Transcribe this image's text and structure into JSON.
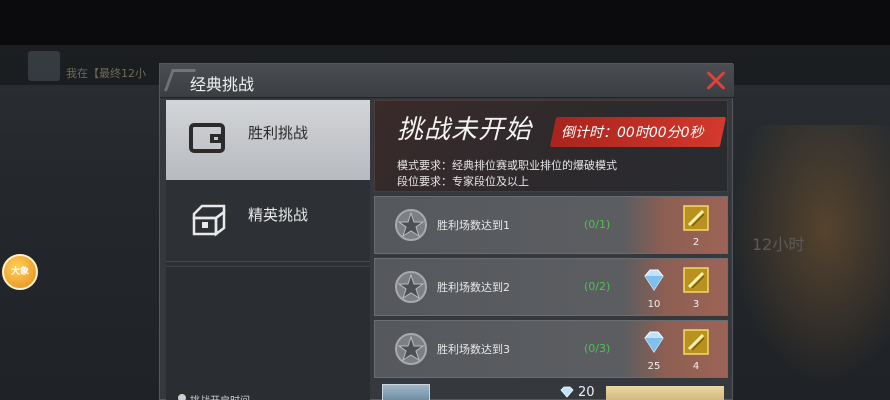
{
  "background": {
    "notice": "我在【最终12小",
    "right_text": "12小时"
  },
  "float_badge": {
    "label": "大象"
  },
  "dialog": {
    "title": "经典挑战",
    "tabs": [
      {
        "label": "胜利挑战",
        "icon": "wallet-icon",
        "selected": true
      },
      {
        "label": "精英挑战",
        "icon": "chest-icon",
        "selected": false
      }
    ],
    "open_time_label": "挑战开启时间",
    "banner": {
      "title": "挑战未开始",
      "countdown": "倒计时：00时00分0秒",
      "mode_requirement": "模式要求：经典排位赛或职业排位的爆破模式",
      "rank_requirement": "段位要求：专家段位及以上"
    },
    "tasks": [
      {
        "name": "胜利场数达到1",
        "progress": "(0/1)",
        "rewards": [
          {
            "icon": "ammo-icon",
            "count": "2"
          }
        ]
      },
      {
        "name": "胜利场数达到2",
        "progress": "(0/2)",
        "rewards": [
          {
            "icon": "diamond-icon",
            "count": "10"
          },
          {
            "icon": "ammo-icon",
            "count": "3"
          }
        ]
      },
      {
        "name": "胜利场数达到3",
        "progress": "(0/3)",
        "rewards": [
          {
            "icon": "diamond-icon",
            "count": "25"
          },
          {
            "icon": "ammo-icon",
            "count": "4"
          }
        ]
      }
    ],
    "chest": {
      "price": "20"
    }
  },
  "colors": {
    "accent_red": "#d3382c",
    "progress_green": "#4fc24f",
    "close_red": "#e0413a"
  }
}
